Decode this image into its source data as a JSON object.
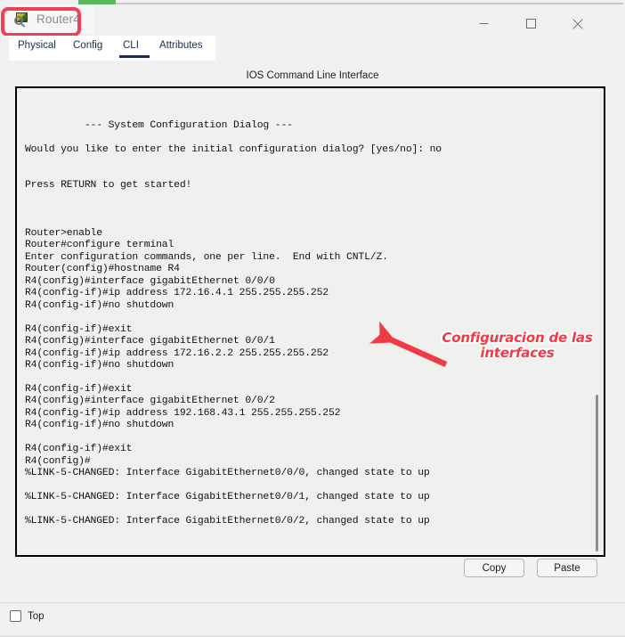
{
  "window": {
    "title": "Router4",
    "icon": "router-magnifier-icon",
    "highlight_color": "#ef4056",
    "controls": {
      "minimize": "minimize-icon",
      "maximize": "maximize-icon",
      "close": "close-icon"
    }
  },
  "tabs": [
    {
      "label": "Physical",
      "active": false
    },
    {
      "label": "Config",
      "active": false
    },
    {
      "label": "CLI",
      "active": true
    },
    {
      "label": "Attributes",
      "active": false
    }
  ],
  "panel": {
    "title": "IOS Command Line Interface"
  },
  "terminal": {
    "content": "\n\n          --- System Configuration Dialog ---\n\nWould you like to enter the initial configuration dialog? [yes/no]: no\n\n\nPress RETURN to get started!\n\n\n\nRouter>enable\nRouter#configure terminal\nEnter configuration commands, one per line.  End with CNTL/Z.\nRouter(config)#hostname R4\nR4(config)#interface gigabitEthernet 0/0/0\nR4(config-if)#ip address 172.16.4.1 255.255.255.252\nR4(config-if)#no shutdown\n\nR4(config-if)#exit\nR4(config)#interface gigabitEthernet 0/0/1\nR4(config-if)#ip address 172.16.2.2 255.255.255.252\nR4(config-if)#no shutdown\n\nR4(config-if)#exit\nR4(config)#interface gigabitEthernet 0/0/2\nR4(config-if)#ip address 192.168.43.1 255.255.255.252\nR4(config-if)#no shutdown\n\nR4(config-if)#exit\nR4(config)#\n%LINK-5-CHANGED: Interface GigabitEthernet0/0/0, changed state to up\n\n%LINK-5-CHANGED: Interface GigabitEthernet0/0/1, changed state to up\n\n%LINK-5-CHANGED: Interface GigabitEthernet0/0/2, changed state to up\n"
  },
  "annotation": {
    "text": "Configuracion de las interfaces",
    "color": "#ef3b46",
    "arrow": "arrow-pointing-left"
  },
  "actions": {
    "copy_label": "Copy",
    "paste_label": "Paste"
  },
  "bottom": {
    "top_checkbox_label": "Top",
    "top_checkbox_checked": false
  }
}
